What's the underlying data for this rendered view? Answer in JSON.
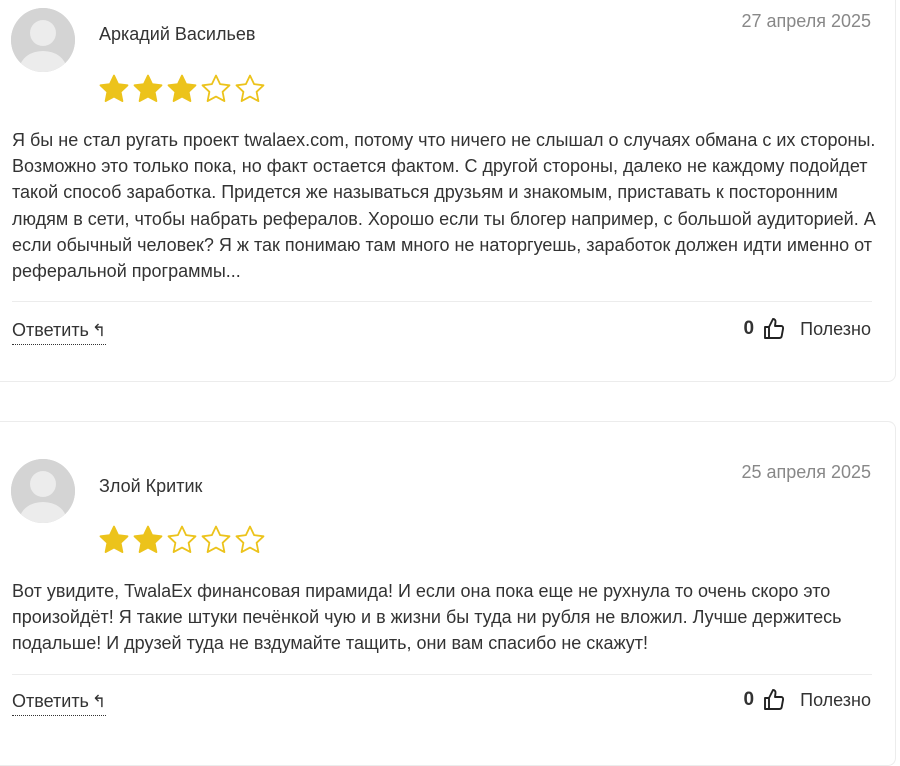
{
  "colors": {
    "star": "#ecc31b",
    "text": "#333333",
    "date": "#888888",
    "divider": "#ececec"
  },
  "reply_label": "Ответить",
  "reply_icon": "reply-arrow-icon",
  "useful_label": "Полезно",
  "reviews": [
    {
      "author": "Аркадий Васильев",
      "date": "27 апреля 2025",
      "rating": 3,
      "max_rating": 5,
      "text": "Я бы не стал ругать проект twalaex.com, потому что ничего не слышал о случаях обмана с их стороны. Возможно это только пока, но факт остается фактом. С другой стороны, далеко не каждому подойдет такой способ заработка. Придется же называться друзьям и знакомым, приставать к посторонним людям в сети, чтобы набрать рефералов. Хорошо если ты блогер например, с большой аудиторией. А если обычный человек? Я ж так понимаю там много не наторгуешь, заработок должен идти именно от реферальной программы...",
      "likes": "0"
    },
    {
      "author": "Злой Критик",
      "date": "25 апреля 2025",
      "rating": 2,
      "max_rating": 5,
      "text": "Вот увидите, TwalaEx финансовая пирамида! И если она пока еще не рухнула то очень скоро это произойдёт! Я такие штуки печёнкой чую и в жизни бы туда ни рубля не вложил. Лучше держитесь подальше! И друзей туда не вздумайте тащить, они вам спасибо не скажут!",
      "likes": "0"
    }
  ]
}
